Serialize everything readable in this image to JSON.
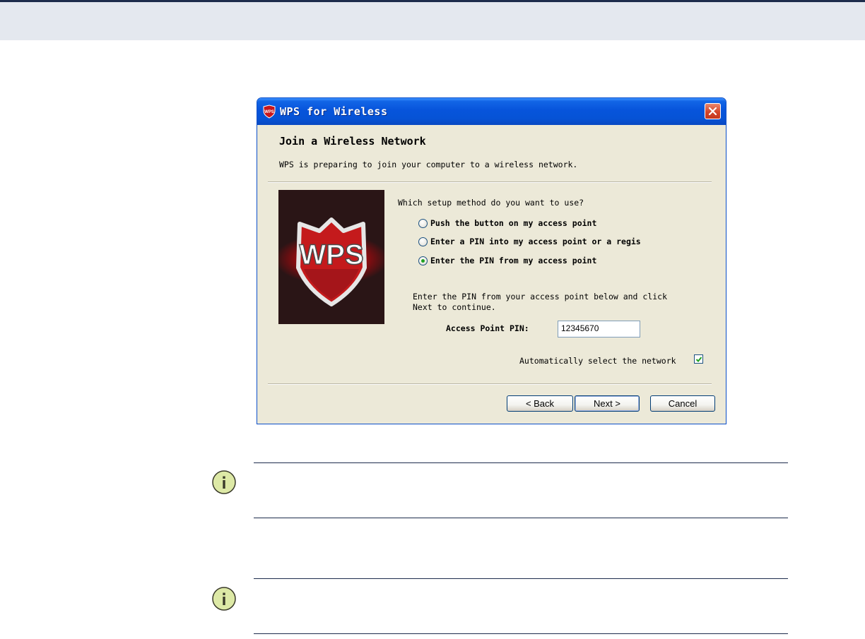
{
  "window": {
    "title": "WPS for Wireless",
    "heading": "Join a Wireless Network",
    "subtitle": "WPS is preparing to join your computer to a wireless network."
  },
  "setup": {
    "question": "Which setup method do you want to use?",
    "options": [
      {
        "label": "Push the button on my access point",
        "selected": false
      },
      {
        "label": "Enter a PIN into my access point or a regis",
        "selected": false
      },
      {
        "label": "Enter the PIN from my access point",
        "selected": true
      }
    ]
  },
  "pin": {
    "instructions_line1": "Enter the PIN from your access point below and click",
    "instructions_line2": "Next to continue.",
    "label": "Access Point PIN:",
    "value": "12345670"
  },
  "auto_select": {
    "label": "Automatically select the network",
    "checked": true
  },
  "buttons": {
    "back": "< Back",
    "next": "Next >",
    "cancel": "Cancel"
  },
  "logo_text": "WPS",
  "colors": {
    "titlebar": "#0754db",
    "dialog_bg": "#ece9d8",
    "note_icon": "#dde9a6",
    "rule": "#1d2c4c"
  }
}
